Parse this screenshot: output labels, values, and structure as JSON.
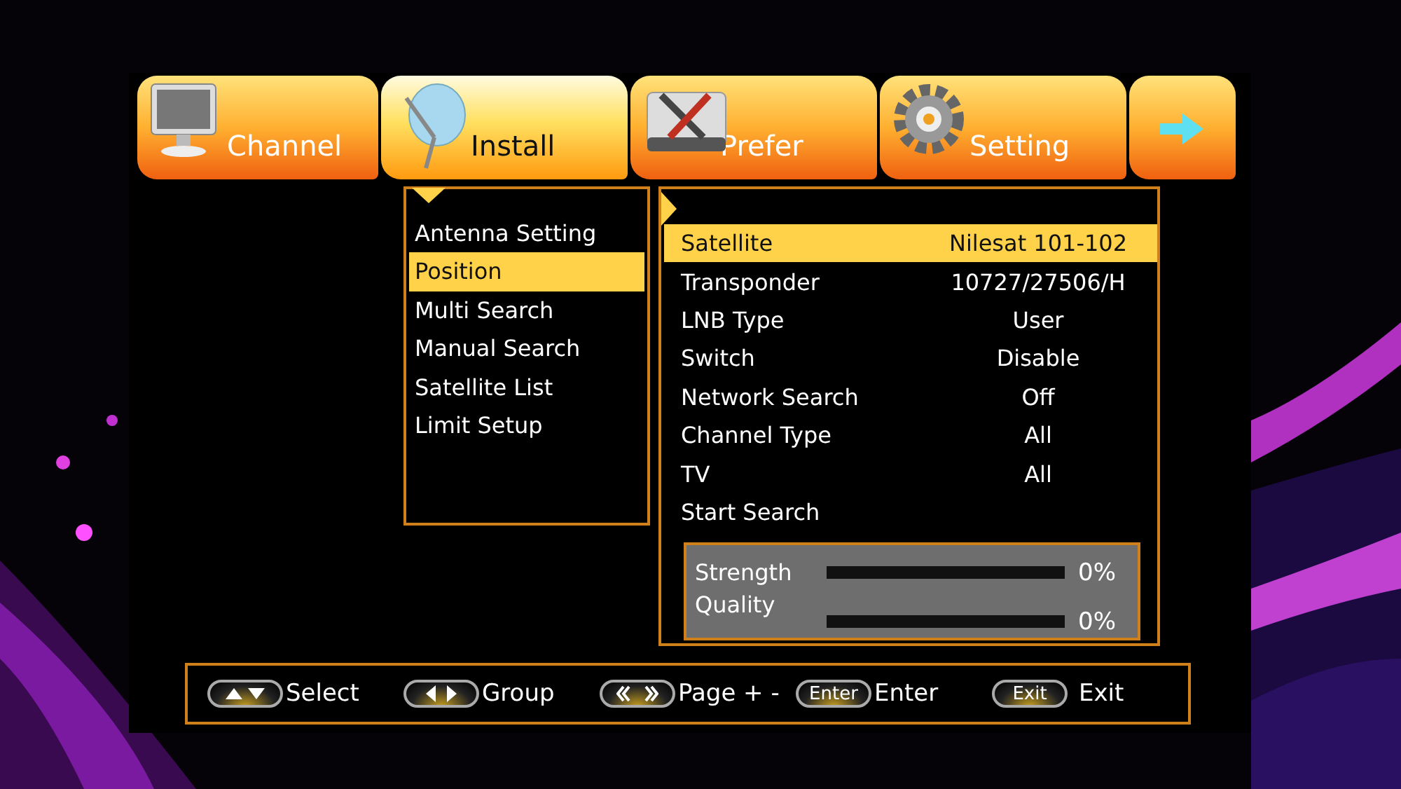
{
  "tabs": [
    {
      "label": "Channel",
      "selected": false
    },
    {
      "label": "Install",
      "selected": true
    },
    {
      "label": "Prefer",
      "selected": false
    },
    {
      "label": "Setting",
      "selected": false
    },
    {
      "selected": false
    }
  ],
  "install_menu": {
    "items": [
      {
        "label": "Antenna Setting",
        "selected": false
      },
      {
        "label": "Position",
        "selected": true
      },
      {
        "label": "Multi Search",
        "selected": false
      },
      {
        "label": "Manual Search",
        "selected": false
      },
      {
        "label": "Satellite List",
        "selected": false
      },
      {
        "label": "Limit Setup",
        "selected": false
      }
    ]
  },
  "position_panel": {
    "rows": [
      {
        "label": "Satellite",
        "value": "Nilesat 101-102",
        "selected": true
      },
      {
        "label": "Transponder",
        "value": "10727/27506/H",
        "selected": false
      },
      {
        "label": "LNB Type",
        "value": "User",
        "selected": false
      },
      {
        "label": "Switch",
        "value": "Disable",
        "selected": false
      },
      {
        "label": "Network Search",
        "value": "Off",
        "selected": false
      },
      {
        "label": "Channel Type",
        "value": "All",
        "selected": false
      },
      {
        "label": "TV",
        "value": "All",
        "selected": false
      },
      {
        "label": "Start Search",
        "selected": false
      }
    ],
    "signal": [
      {
        "label": "Strength",
        "reading": "0%"
      },
      {
        "label": "Quality",
        "reading": "0%"
      }
    ]
  },
  "help_bar": [
    {
      "kind": "updown",
      "action": "Select"
    },
    {
      "kind": "leftright",
      "action": "Group"
    },
    {
      "kind": "page",
      "action": "Page + -"
    },
    {
      "kind": "text",
      "key": "Enter",
      "action": "Enter"
    },
    {
      "kind": "text",
      "key": "Exit",
      "action": "Exit"
    }
  ]
}
